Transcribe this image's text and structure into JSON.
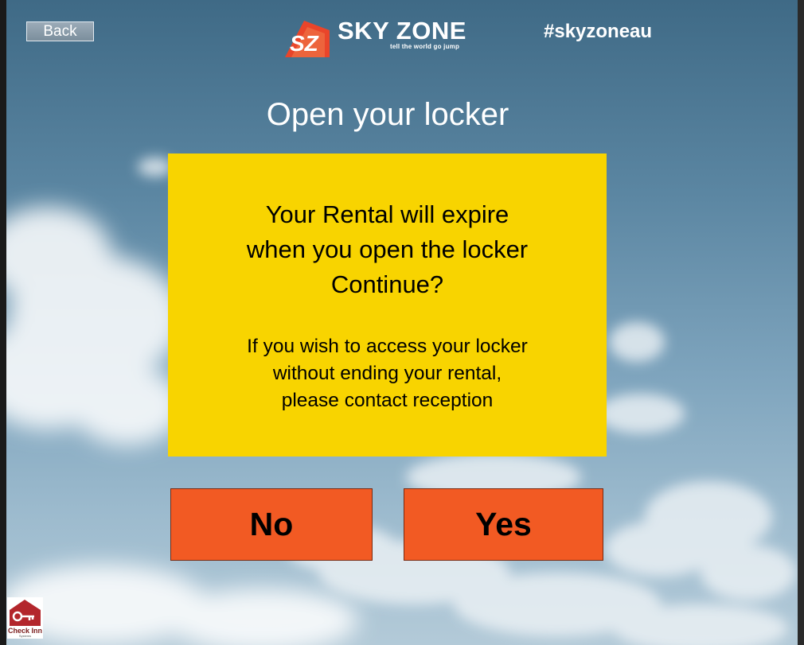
{
  "header": {
    "back_label": "Back",
    "logo_mark": "SZ",
    "logo_name": "SKY ZONE",
    "logo_tagline": "tell the world go jump",
    "hashtag": "#skyzoneau"
  },
  "page_title": "Open your locker",
  "dialog": {
    "heading_lines": [
      "Your Rental will expire",
      "when you open the locker",
      "Continue?"
    ],
    "info_lines": [
      "If you wish to access your locker",
      "without ending your rental,",
      "please contact reception"
    ]
  },
  "actions": {
    "no_label": "No",
    "yes_label": "Yes"
  },
  "footer": {
    "badge_name": "Check Inn",
    "badge_sub": "Systems"
  },
  "colors": {
    "dialog_background": "#f8d400",
    "button_background": "#f25a23",
    "logo_accent": "#e9452a",
    "text_white": "#ffffff"
  }
}
